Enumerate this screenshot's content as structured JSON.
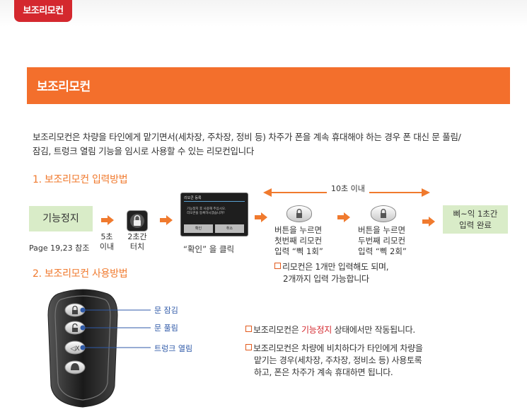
{
  "header": {
    "tag": "보조리모컨"
  },
  "banner": {
    "title": "보조리모컨"
  },
  "intro": {
    "line1": "보조리모컨은 차량을 타인에게 맡기면서(세차장, 주차장, 정비 등) 차주가 폰을 계속 휴대해야 하는 경우 폰 대신 문 풀림/",
    "line2": "잠김,  트렁크 열림 기능을 임시로 사용할 수 있는 리모컨입니다"
  },
  "section1": {
    "title": "1. 보조리모컨 입력방법",
    "step_stop": "기능정지",
    "page_ref": "Page 19,23 참조",
    "step_5s_line1": "5초",
    "step_5s_line2": "이내",
    "step_2s_line1": "2초간",
    "step_2s_line2": "터치",
    "dialog": {
      "title": "리모콘 등록",
      "body_line1": "기능정지 후 사용해 주십시오.",
      "body_line2": "리모콘을 등록하시겠습니까?",
      "ok": "확인",
      "cancel": "취소"
    },
    "confirm_caption": "“확인”  을 클릭",
    "time_limit": "10초 이내",
    "first_line1": "버튼을 누르면",
    "first_line2": "첫번째 리모컨",
    "first_line3": "입력    “삑 1회”",
    "second_line1": "버튼을 누르면",
    "second_line2": "두번째 리모컨",
    "second_line3": "입력    “삑 2회”",
    "done_line1": "삐~익 1초간",
    "done_line2": "입력 완료",
    "note_line1": "리모컨은 1개만 입력해도 되며,",
    "note_line2": "2개까지 입력 가능합니다"
  },
  "section2": {
    "title": "2. 보조리모컨 사용방법",
    "label_lock": "문 잠김",
    "label_unlock": "문 풀림",
    "label_trunk": "트렁크 열림",
    "note1_pre": "보조리모컨은 ",
    "note1_red": "기능정지",
    "note1_post": " 상태에서만 작동됩니다.",
    "note2_line1": "보조리모컨은 차량에 비치하다가 타인에게 차량을",
    "note2_line2": "맡기는 경우(세차장, 주차장, 정비소 등) 사용토록",
    "note2_line3": "하고, 폰은 차주가 계속 휴대하면 됩니다."
  },
  "colors": {
    "accent": "#f36f2c",
    "tag": "#d4282e",
    "green_box": "#d9ecc8",
    "link_blue": "#2f5aa8"
  }
}
